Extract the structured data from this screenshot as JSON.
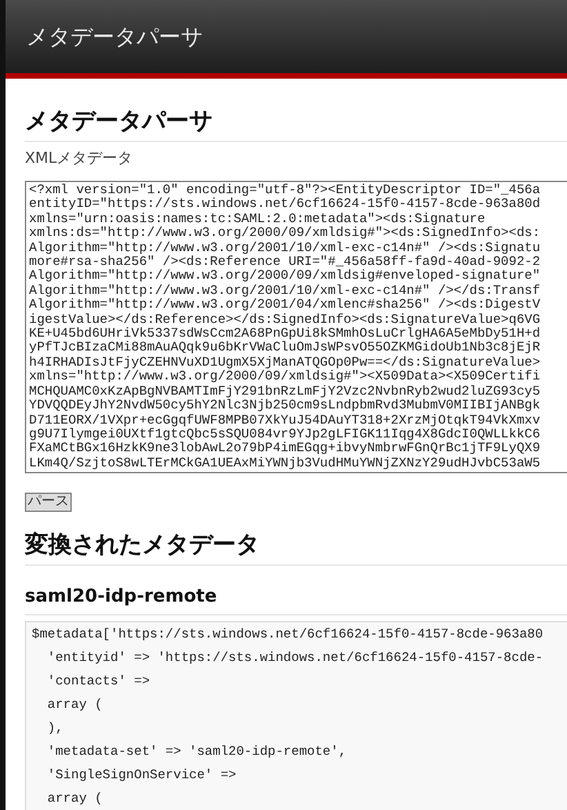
{
  "header": {
    "title": "メタデータパーサ"
  },
  "parser": {
    "heading": "メタデータパーサ",
    "label": "XMLメタデータ",
    "xml_input": {
      "value_lines": [
        "<?xml version=\"1.0\" encoding=\"utf-8\"?><EntityDescriptor ID=\"_456a",
        "entityID=\"https://sts.windows.net/6cf16624-15f0-4157-8cde-963a80d",
        "xmlns=\"urn:oasis:names:tc:SAML:2.0:metadata\"><ds:Signature",
        "xmlns:ds=\"http://www.w3.org/2000/09/xmldsig#\"><ds:SignedInfo><ds:",
        "Algorithm=\"http://www.w3.org/2001/10/xml-exc-c14n#\" /><ds:Signatu",
        "more#rsa-sha256\" /><ds:Reference URI=\"#_456a58ff-fa9d-40ad-9092-2",
        "Algorithm=\"http://www.w3.org/2000/09/xmldsig#enveloped-signature\"",
        "Algorithm=\"http://www.w3.org/2001/10/xml-exc-c14n#\" /></ds:Transf",
        "Algorithm=\"http://www.w3.org/2001/04/xmlenc#sha256\" /><ds:DigestV",
        "igestValue></ds:Reference></ds:SignedInfo><ds:SignatureValue>q6VG",
        "KE+U45bd6UHriVk5337sdWsCcm2A68PnGpUi8kSMmhOsLuCrlgHA6A5eMbDy51H+d",
        "yPfTJcBIzaCMi88mAuAQqk9u6bKrVWaCluOmJsWPsvO55OZKMGidoUb1Nb3c8jEjR",
        "h4IRHADIsJtFjyCZEHNVuXD1UgmX5XjManATQGOp0Pw==</ds:SignatureValue>",
        "xmlns=\"http://www.w3.org/2000/09/xmldsig#\"><X509Data><X509Certifi",
        "MCHQUAMC0xKzApBgNVBAMTImFjY291bnRzLmFjY2Vzc2NvbnRyb2wud2luZG93cy5",
        "YDVQQDEyJhY2NvdW50cy5hY2Nlc3Njb250cm9sLndpbmRvd3MubmV0MIIBIjANBgk",
        "D711EORX/1VXpr+ecGgqfUWF8MPB07XkYuJ54DAuYT318+2XrzMjOtqkT94VkXmxv",
        "g9U7Ilymgei0UXtf1gtcQbc5sSQU084vr9YJp2gLFIGK11Iqg4X8GdcI0QWLLkkC6",
        "FXaMCtBGx16HzkK9ne3lobAwL2o79bP4imEGqg+ibvyNmbrwFGnQrBc1jTF9LyQX9",
        "LKm4Q/SzjtoS8wLTErMCkGA1UEAxMiYWNjb3VudHMuYWNjZXNzY29udHJvbC53aW5"
      ]
    },
    "parse_button": "パース"
  },
  "output": {
    "heading": "変換されたメタデータ",
    "subheading": "saml20-idp-remote",
    "code_lines": [
      "$metadata['https://sts.windows.net/6cf16624-15f0-4157-8cde-963a80",
      "  'entityid' => 'https://sts.windows.net/6cf16624-15f0-4157-8cde-",
      "  'contacts' =>",
      "  array (",
      "  ),",
      "  'metadata-set' => 'saml20-idp-remote',",
      "  'SingleSignOnService' =>",
      "  array ("
    ]
  }
}
